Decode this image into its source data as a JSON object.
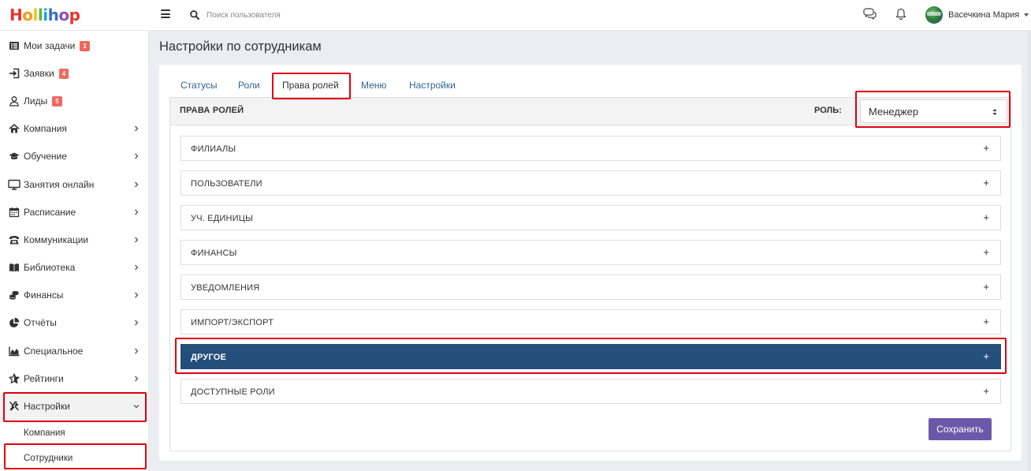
{
  "app": {
    "logo_letters": [
      "H",
      "o",
      "l",
      "l",
      "i",
      "h",
      "o",
      "p"
    ],
    "logo_colors": [
      "#e8362c",
      "#f39a1e",
      "#f4c21b",
      "#5bb543",
      "#1aa6d6",
      "#3a6fc4",
      "#8a4fb5",
      "#e8362c"
    ]
  },
  "header": {
    "search_placeholder": "Поиск пользователя",
    "user_name": "Васечкина Мария",
    "icons": [
      "menu-icon",
      "search-icon",
      "chat-icon",
      "bell-icon"
    ]
  },
  "sidebar": {
    "items": [
      {
        "label": "Мои задачи",
        "icon": "tasks-icon",
        "badge": "1",
        "chevron": false
      },
      {
        "label": "Заявки",
        "icon": "requests-icon",
        "badge": "4",
        "chevron": false
      },
      {
        "label": "Лиды",
        "icon": "user-icon",
        "badge": "5",
        "chevron": false
      },
      {
        "label": "Компания",
        "icon": "home-icon",
        "badge": "",
        "chevron": true
      },
      {
        "label": "Обучение",
        "icon": "graduation-cap-icon",
        "badge": "",
        "chevron": true
      },
      {
        "label": "Занятия онлайн",
        "icon": "monitor-icon",
        "badge": "",
        "chevron": true
      },
      {
        "label": "Расписание",
        "icon": "calendar-icon",
        "badge": "",
        "chevron": true
      },
      {
        "label": "Коммуникации",
        "icon": "phone-icon",
        "badge": "",
        "chevron": true
      },
      {
        "label": "Библиотека",
        "icon": "book-icon",
        "badge": "",
        "chevron": true
      },
      {
        "label": "Финансы",
        "icon": "coins-icon",
        "badge": "",
        "chevron": true
      },
      {
        "label": "Отчёты",
        "icon": "pie-chart-icon",
        "badge": "",
        "chevron": true
      },
      {
        "label": "Специальное",
        "icon": "area-chart-icon",
        "badge": "",
        "chevron": true
      },
      {
        "label": "Рейтинги",
        "icon": "star-icon",
        "badge": "",
        "chevron": true
      },
      {
        "label": "Настройки",
        "icon": "tools-icon",
        "badge": "",
        "chevron": true,
        "expanded": true
      }
    ],
    "subitems": [
      {
        "label": "Компания"
      },
      {
        "label": "Сотрудники"
      }
    ]
  },
  "main": {
    "title": "Настройки по сотрудникам",
    "tabs": [
      {
        "label": "Статусы",
        "active": false
      },
      {
        "label": "Роли",
        "active": false
      },
      {
        "label": "Права ролей",
        "active": true
      },
      {
        "label": "Меню",
        "active": false
      },
      {
        "label": "Настройки",
        "active": false
      }
    ],
    "section_title": "ПРАВА РОЛЕЙ",
    "role_label": "РОЛЬ:",
    "role_value": "Менеджер",
    "panels": [
      {
        "label": "ФИЛИАЛЫ",
        "toggle": "+",
        "selected": false
      },
      {
        "label": "ПОЛЬЗОВАТЕЛИ",
        "toggle": "+",
        "selected": false
      },
      {
        "label": "УЧ. ЕДИНИЦЫ",
        "toggle": "+",
        "selected": false
      },
      {
        "label": "ФИНАНСЫ",
        "toggle": "+",
        "selected": false
      },
      {
        "label": "УВЕДОМЛЕНИЯ",
        "toggle": "+",
        "selected": false
      },
      {
        "label": "ИМПОРТ/ЭКСПОРТ",
        "toggle": "+",
        "selected": false
      },
      {
        "label": "ДРУГОЕ",
        "toggle": "+",
        "selected": true
      },
      {
        "label": "ДОСТУПНЫЕ РОЛИ",
        "toggle": "+",
        "selected": false
      }
    ],
    "save_label": "Сохранить"
  },
  "colors": {
    "accent_dark_blue": "#244f7a",
    "link_blue": "#2f6496",
    "save_purple": "#6a58a8",
    "badge_red": "#f0685d",
    "highlight_red": "#e0000f"
  }
}
